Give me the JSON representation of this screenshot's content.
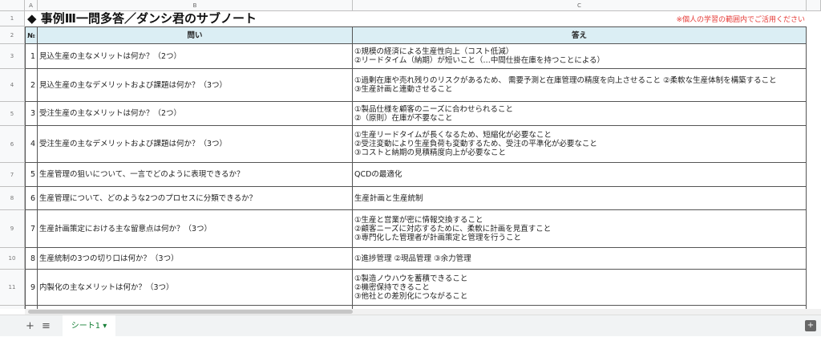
{
  "columns": [
    "A",
    "B",
    "C"
  ],
  "title": "◆ 事例Ⅲ一問多答／ダンシ君のサブノート",
  "note": "※個人の学習の範囲内でご活用ください",
  "headers": {
    "no": "№",
    "question": "問い",
    "answer": "答え"
  },
  "row_numbers": [
    "1",
    "2",
    "3",
    "4",
    "5",
    "6",
    "7",
    "8",
    "9",
    "10",
    "11"
  ],
  "rows": [
    {
      "no": "1",
      "question": "見込生産の主なメリットは何か？（2つ）",
      "answer": "①規模の経済による生産性向上（コスト低減）\n②リードタイム（納期）が短いこと（…中間仕掛在庫を持つことによる）"
    },
    {
      "no": "2",
      "question": "見込生産の主なデメリットおよび課題は何か？（3つ）",
      "answer": "①過剰在庫や売れ残りのリスクがあるため、 需要予測と在庫管理の精度を向上させること ②柔軟な生産体制を構築すること\n③生産計画と連動させること"
    },
    {
      "no": "3",
      "question": "受注生産の主なメリットは何か？（2つ）",
      "answer": "①製品仕様を顧客のニーズに合わせられること\n②（原則）在庫が不要なこと"
    },
    {
      "no": "4",
      "question": "受注生産の主なデメリットおよび課題は何か？（3つ）",
      "answer": "①生産リードタイムが長くなるため、短縮化が必要なこと\n②受注変動により生産負荷も変動するため、受注の平準化が必要なこと\n③コストと納期の見積精度向上が必要なこと"
    },
    {
      "no": "5",
      "question": "生産管理の狙いについて、一言でどのように表現できるか？",
      "answer": "QCDの最適化"
    },
    {
      "no": "6",
      "question": "生産管理について、どのような2つのプロセスに分類できるか？",
      "answer": "生産計画と生産統制"
    },
    {
      "no": "7",
      "question": "生産計画策定における主な留意点は何か？（3つ）",
      "answer": "①生産と営業が密に情報交換すること\n②顧客ニーズに対応するために、柔軟に計画を見直すこと\n③専門化した管理者が計画策定と管理を行うこと"
    },
    {
      "no": "8",
      "question": "生産統制の3つの切り口は何か？（3つ）",
      "answer": "①進捗管理 ②現品管理 ③余力管理"
    },
    {
      "no": "9",
      "question": "内製化の主なメリットは何か？（3つ）",
      "answer": "①製造ノウハウを蓄積できること\n②機密保持できること\n③他社との差別化につながること"
    }
  ],
  "bottom": {
    "add_sheet": "+",
    "all_sheets": "≡",
    "sheet_tab": "シート1 ▾",
    "explore": "+"
  },
  "colors": {
    "header_bg": "#dbeef4",
    "note": "#e53935",
    "tab": "#188038"
  }
}
